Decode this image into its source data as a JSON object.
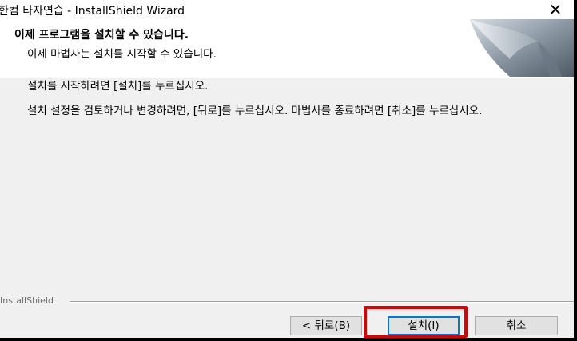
{
  "window": {
    "title": "한컴 타자연습 - InstallShield Wizard",
    "close_glyph": "✕"
  },
  "header": {
    "title": "이제 프로그램을 설치할 수 있습니다.",
    "subtitle": "이제 마법사는 설치를 시작할 수 있습니다."
  },
  "body": {
    "line1": "설치를 시작하려면 [설치]를 누르십시오.",
    "line2": "설치 설정을 검토하거나 변경하려면, [뒤로]를 누르십시오. 마법사를 종료하려면 [취소]를 누르십시오."
  },
  "footer": {
    "brand": "InstallShield"
  },
  "buttons": {
    "back": "< 뒤로(B)",
    "install": "설치(I)",
    "cancel": "취소"
  },
  "colors": {
    "highlight": "#e00000",
    "focus": "#0078d7"
  }
}
